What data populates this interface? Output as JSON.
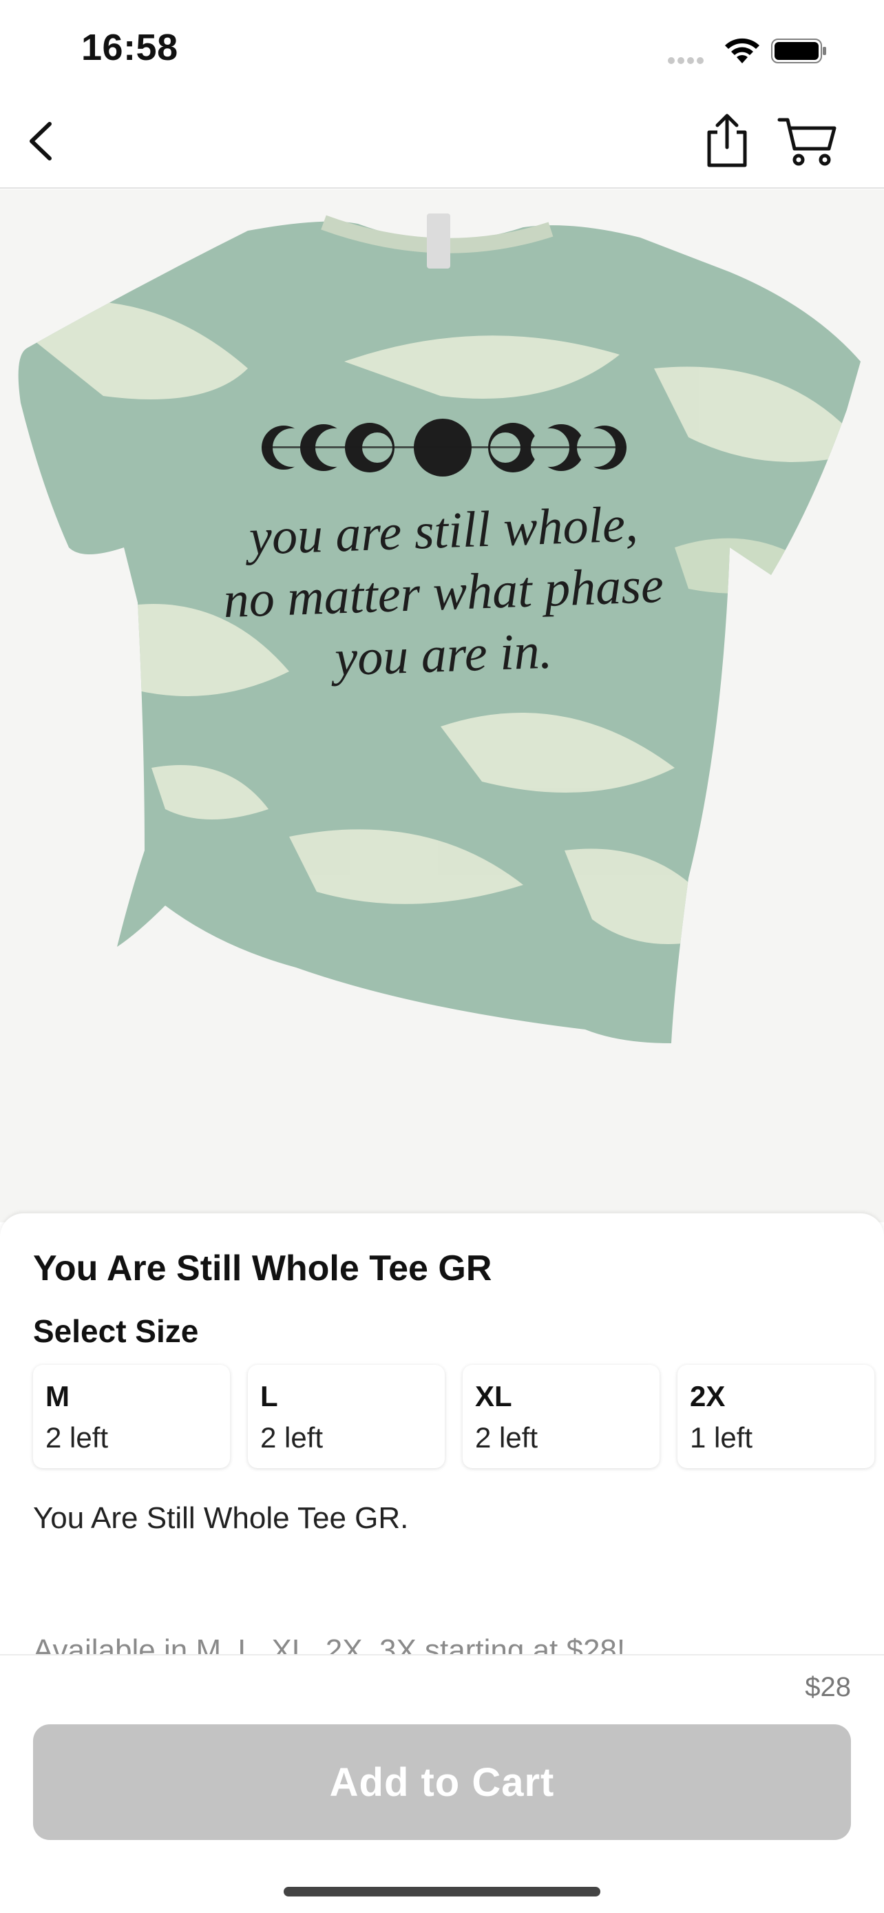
{
  "status_bar": {
    "time": "16:58",
    "icons": [
      "signal-dots-icon",
      "wifi-icon",
      "battery-icon"
    ]
  },
  "nav": {
    "icons": [
      "back-chevron-icon",
      "share-icon",
      "cart-icon"
    ]
  },
  "product": {
    "image_alt": "Sage bleached tee with moon phases",
    "shirt_print": {
      "line1": "you are still whole,",
      "line2": "no matter what phase",
      "line3": "you are in."
    },
    "title": "You Are Still Whole Tee GR",
    "size_heading": "Select Size",
    "sizes": [
      {
        "name": "M",
        "stock": "2 left"
      },
      {
        "name": "L",
        "stock": "2 left"
      },
      {
        "name": "XL",
        "stock": "2 left"
      },
      {
        "name": "2X",
        "stock": "1 left"
      }
    ],
    "description": "You Are Still Whole Tee GR.",
    "availability": "Available in M, L, XL, 2X, 3X starting at $28!"
  },
  "footer": {
    "price": "$28",
    "add_to_cart_label": "Add to Cart"
  },
  "colors": {
    "shirt_base": "#9fbfae",
    "shirt_bleach": "#e6ecd8",
    "button_disabled": "#c3c3c3"
  }
}
